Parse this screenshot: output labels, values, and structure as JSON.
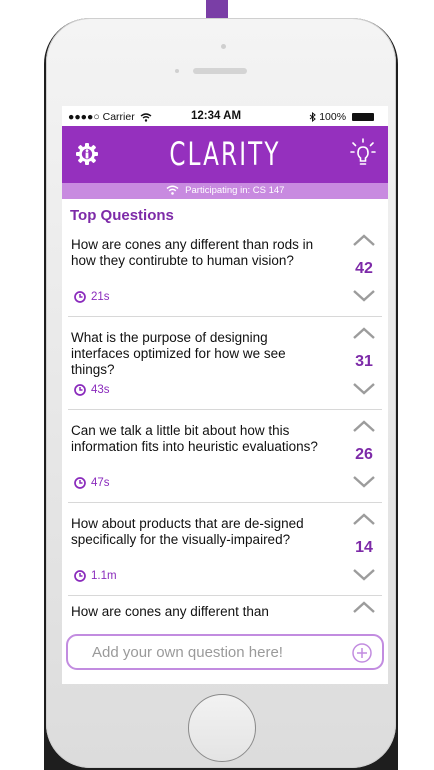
{
  "status_bar": {
    "carrier": "●●●●○ Carrier",
    "time": "12:34 AM",
    "battery": "100%"
  },
  "header": {
    "title": "CLARITY",
    "brand_color": "#9530be"
  },
  "subbar": {
    "text": "Participating in: CS 147"
  },
  "section_title": "Top Questions",
  "questions": [
    {
      "text": "How are cones any different than rods in how they contirubte to human vision?",
      "time": "21s",
      "votes": "42"
    },
    {
      "text": "What is the purpose of designing interfaces optimized for how we see things?",
      "time": "43s",
      "votes": "31"
    },
    {
      "text": "Can we talk a little bit about how this information fits into heuristic evaluations?",
      "time": "47s",
      "votes": "26"
    },
    {
      "text": "How about products that are de-signed specifically for the visually-impaired?",
      "time": "1.1m",
      "votes": "14"
    }
  ],
  "partial_question": {
    "text": "How are cones any different than"
  },
  "add_question": {
    "placeholder": "Add your own question here!"
  },
  "icons": {
    "settings": "gear-icon",
    "idea": "lightbulb-icon",
    "wifi": "wifi-icon",
    "time": "clock-icon",
    "upvote": "chevron-up-icon",
    "downvote": "chevron-down-icon",
    "add": "plus-circle-icon"
  }
}
